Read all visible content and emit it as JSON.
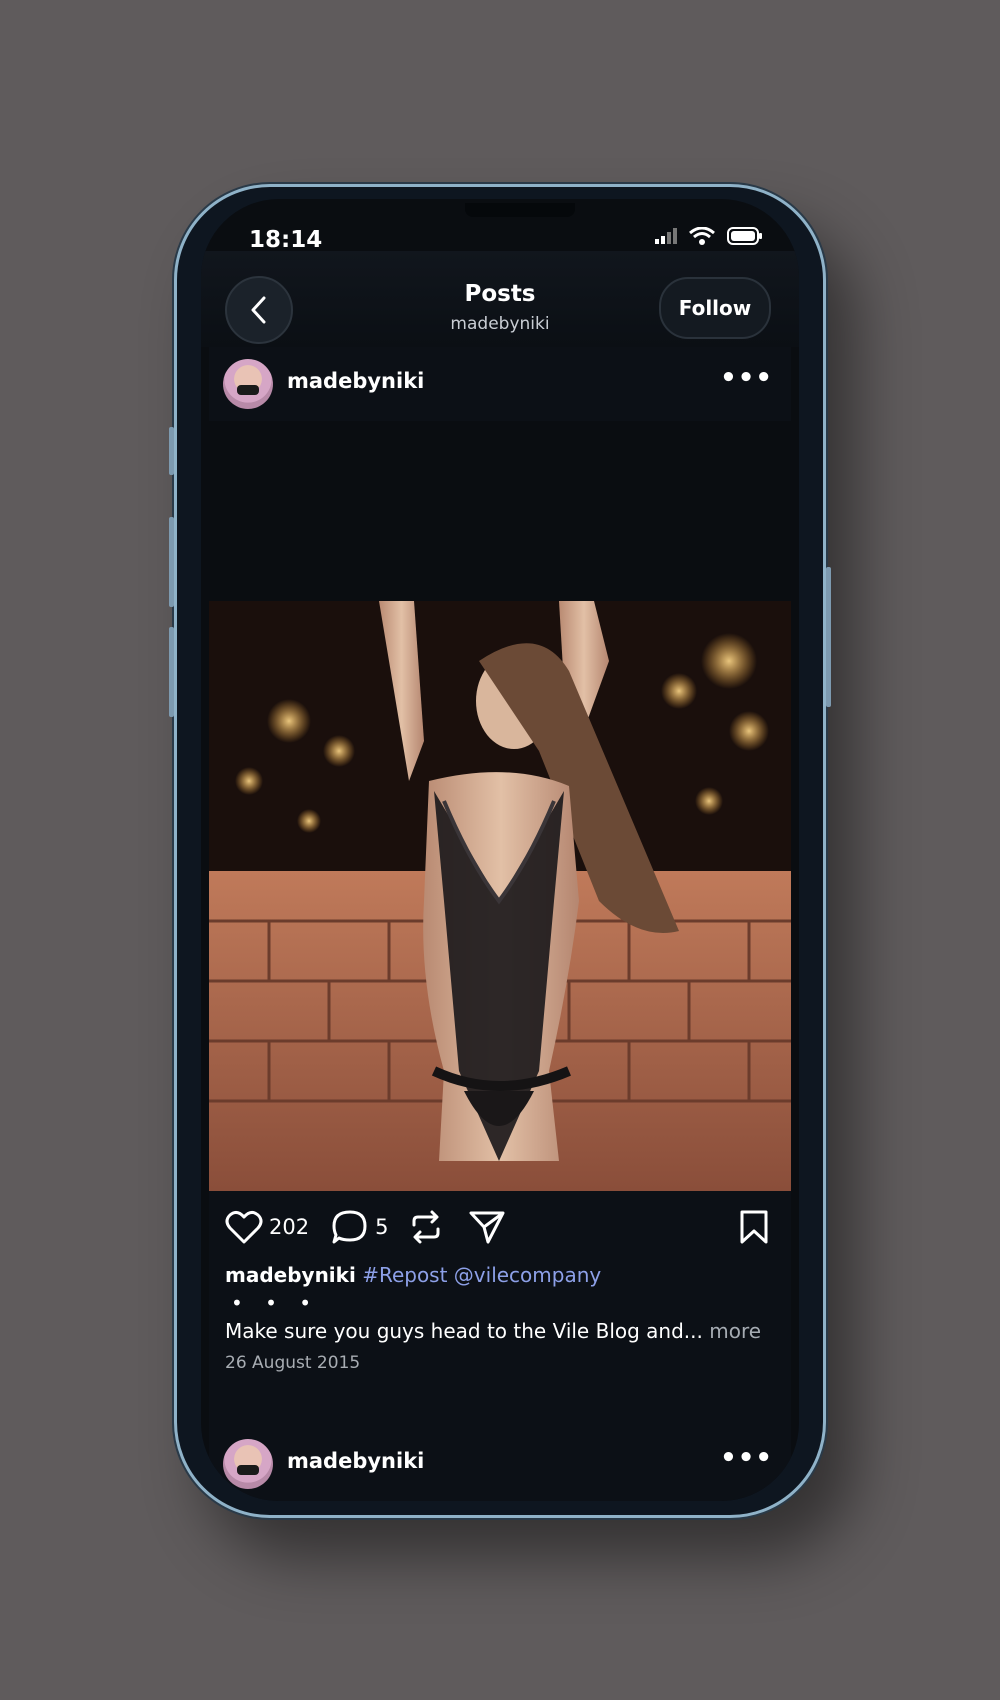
{
  "status_bar": {
    "time": "18:14"
  },
  "header": {
    "title": "Posts",
    "subtitle": "madebyniki",
    "follow_label": "Follow"
  },
  "posts": [
    {
      "username": "madebyniki",
      "likes": "202",
      "comments": "5",
      "caption_user": "madebyniki",
      "caption_tags": "#Repost @vilecompany",
      "caption_dots": "• • •",
      "caption_text": "Make sure you guys head to the Vile Blog and...",
      "more_label": "more",
      "date": "26 August 2015"
    },
    {
      "username": "madebyniki"
    }
  ],
  "icons": {
    "back": "chevron-left-icon",
    "more": "more-horizontal-icon",
    "like": "heart-icon",
    "comment": "comment-bubble-icon",
    "repost": "repost-icon",
    "share": "send-icon",
    "save": "bookmark-icon"
  },
  "colors": {
    "background": "#5f5b5c",
    "screen": "#0a0d11",
    "hashtag": "#8da0e8"
  }
}
